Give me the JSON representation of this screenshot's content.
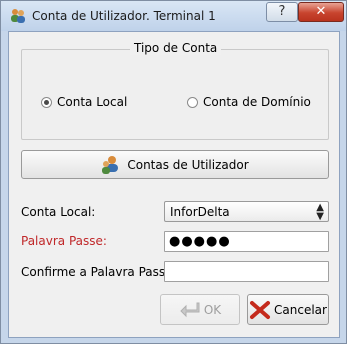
{
  "window": {
    "title": "Conta de Utilizador. Terminal 1",
    "help_label": "?",
    "close_label": "✕"
  },
  "account_type": {
    "group_title": "Tipo de Conta",
    "options": [
      {
        "label": "Conta Local",
        "selected": true
      },
      {
        "label": "Conta de Domínio",
        "selected": false
      }
    ]
  },
  "user_accounts_button": {
    "label": "Contas de Utilizador",
    "icon": "users-icon"
  },
  "form": {
    "local_account_label": "Conta Local:",
    "local_account_value": "InforDelta",
    "password_label": "Palavra Passe:",
    "password_value": "●●●●●",
    "confirm_label": "Confirme a Palavra Passe:",
    "confirm_value": ""
  },
  "buttons": {
    "ok_label": "OK",
    "cancel_label": "Cancelar"
  },
  "colors": {
    "required_label": "#c0282a",
    "titlebar": "#c6d6ea"
  }
}
